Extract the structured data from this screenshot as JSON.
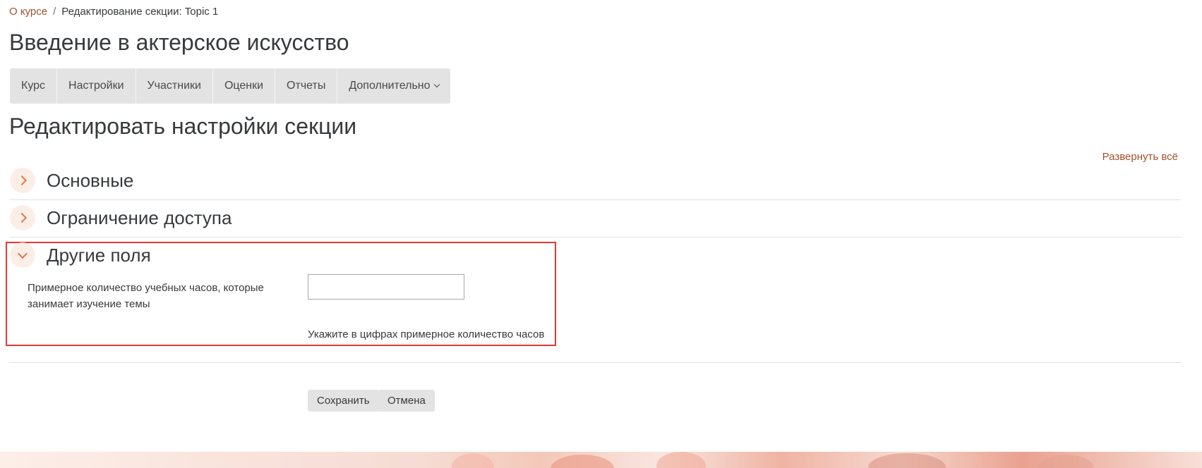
{
  "breadcrumb": {
    "link": "О курсе",
    "separator": "/",
    "current": "Редактирование секции: Topic 1"
  },
  "course_title": "Введение в актерское искусство",
  "nav": {
    "tabs": [
      "Курс",
      "Настройки",
      "Участники",
      "Оценки",
      "Отчеты"
    ],
    "more": "Дополнительно"
  },
  "page_title": "Редактировать настройки секции",
  "expand_all": "Развернуть всё",
  "sections": {
    "general": "Основные",
    "restrict": "Ограничение доступа",
    "other": "Другие поля"
  },
  "field": {
    "label": "Примерное количество учебных часов, которые занимает изучение темы",
    "value": "",
    "help": "Укажите в цифрах примерное количество часов"
  },
  "buttons": {
    "save": "Сохранить",
    "cancel": "Отмена"
  },
  "colors": {
    "link": "#a0522d",
    "accent": "#e07a45",
    "highlight": "#e53935"
  }
}
